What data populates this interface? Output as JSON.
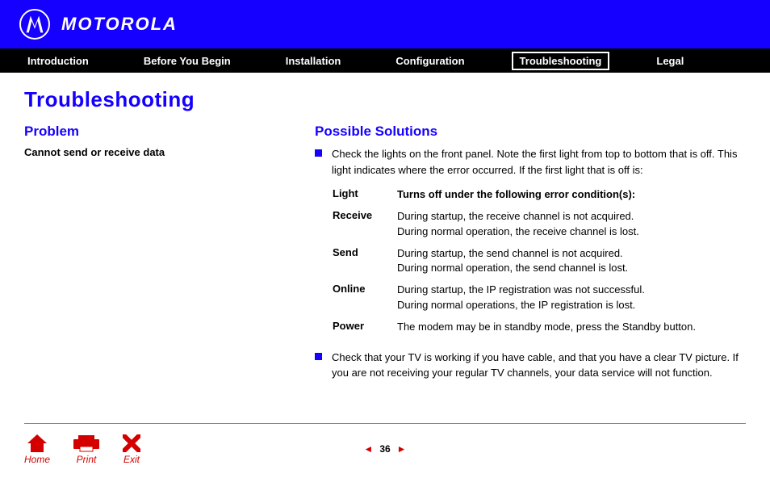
{
  "brand": {
    "wordmark": "MOTOROLA"
  },
  "nav": {
    "items": [
      {
        "label": "Introduction",
        "active": false
      },
      {
        "label": "Before You Begin",
        "active": false
      },
      {
        "label": "Installation",
        "active": false
      },
      {
        "label": "Configuration",
        "active": false
      },
      {
        "label": "Troubleshooting",
        "active": true
      },
      {
        "label": "Legal",
        "active": false
      }
    ]
  },
  "page": {
    "title": "Troubleshooting",
    "problem_heading": "Problem",
    "problem_text": "Cannot send or receive data",
    "solutions_heading": "Possible Solutions",
    "bullet1": "Check the lights on the front panel. Note the first light from top to bottom that is off. This light indicates where the error occurred. If the first light that is off is:",
    "table": {
      "col1": "Light",
      "col2": "Turns off under the following error condition(s):",
      "rows": [
        {
          "light": "Receive",
          "cond": "During startup, the receive channel is not acquired.\nDuring normal operation, the receive channel is lost."
        },
        {
          "light": "Send",
          "cond": "During startup, the send channel is not acquired.\nDuring normal operation, the send channel is lost."
        },
        {
          "light": "Online",
          "cond": "During startup, the IP registration was not successful.\nDuring normal operations, the IP registration is lost."
        },
        {
          "light": "Power",
          "cond": "The modem may be in standby mode, press the Standby button."
        }
      ]
    },
    "bullet2": "Check that your TV is working if you have cable, and that you have a clear TV picture. If you are not receiving your regular TV channels, your data service will not function."
  },
  "footer": {
    "home": "Home",
    "print": "Print",
    "exit": "Exit",
    "page": "36"
  }
}
